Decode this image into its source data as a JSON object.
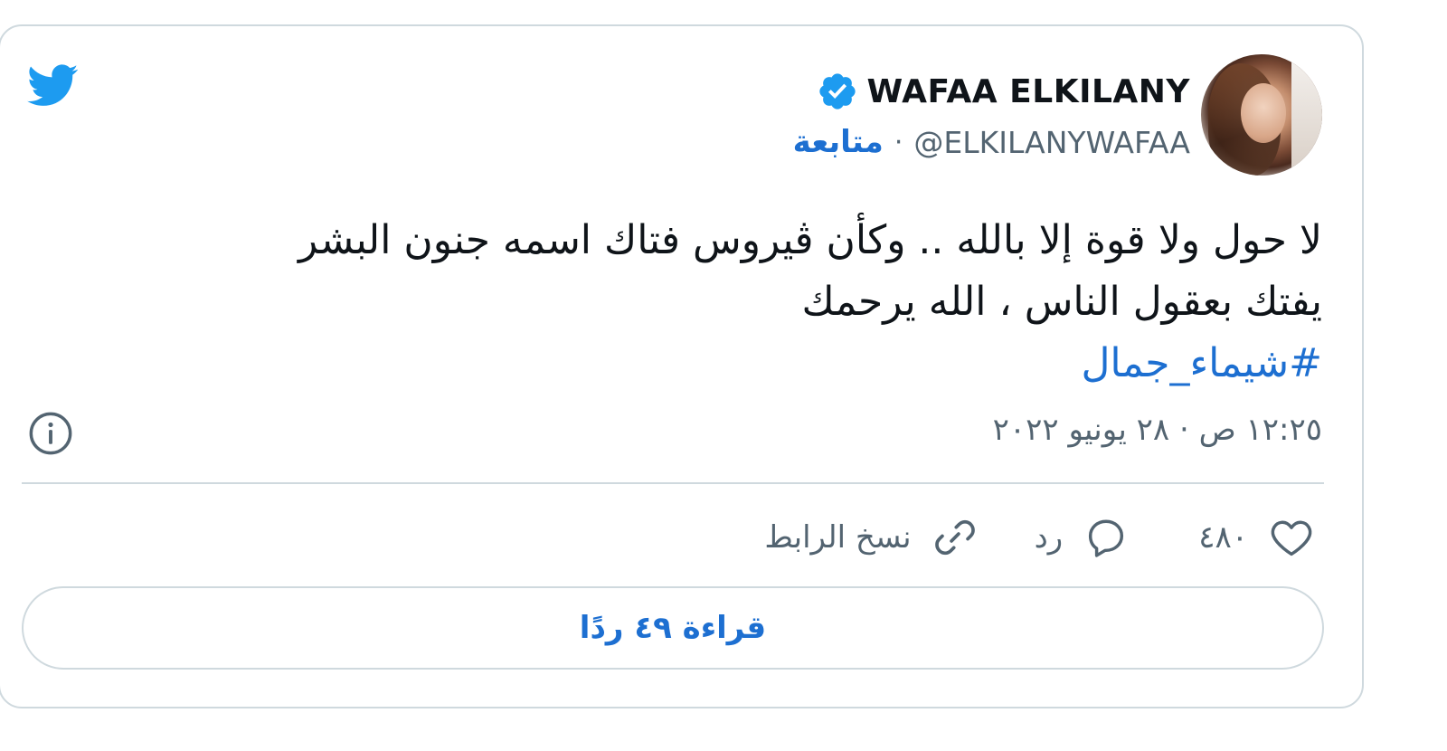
{
  "author": {
    "display_name": "WAFAA ELKILANY",
    "handle": "@ELKILANYWAFAA",
    "separator": "·",
    "follow_label": "متابعة",
    "verified": true
  },
  "tweet": {
    "lines": [
      "لا حول ولا قوة إلا بالله .. وكأن ڤيروس فتاك اسمه جنون البشر",
      "يفتك بعقول الناس ، الله يرحمك"
    ],
    "hashtag": "#شيماء_جمال",
    "timestamp": "١٢:٢٥ ص · ٢٨ يونيو ٢٠٢٢"
  },
  "actions": {
    "like_count": "٤٨٠",
    "reply_label": "رد",
    "copy_link_label": "نسخ الرابط"
  },
  "read_replies_label": "قراءة ٤٩ ردًا",
  "icons": {
    "brand": "twitter-bird-icon",
    "info": "info-icon",
    "like": "heart-icon",
    "reply": "speech-bubble-icon",
    "copy": "link-icon",
    "verified": "verified-badge-icon"
  },
  "colors": {
    "brand_blue": "#1d9bf0",
    "link_blue": "#1d6fd1",
    "text": "#0f1419",
    "muted": "#536471",
    "border": "#cfd9de"
  }
}
